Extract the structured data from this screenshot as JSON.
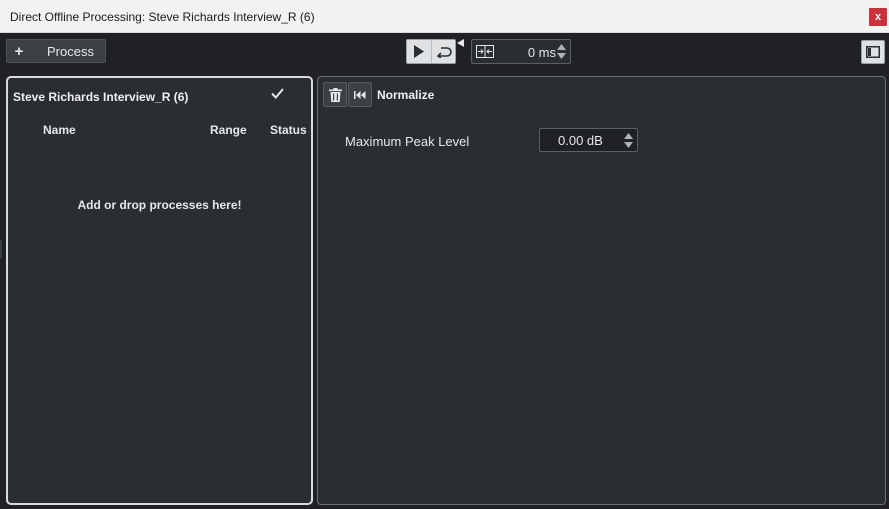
{
  "window": {
    "title": "Direct Offline Processing: Steve Richards Interview_R (6)",
    "close_label": "x"
  },
  "toolbar": {
    "process_label": "Process",
    "add_symbol": "+",
    "preroll_value": "0 ms"
  },
  "left_panel": {
    "title": "Steve Richards Interview_R (6)",
    "columns": {
      "name": "Name",
      "range": "Range",
      "status": "Status"
    },
    "empty_hint": "Add or drop processes here!"
  },
  "right_panel": {
    "title": "Normalize",
    "param_label": "Maximum Peak Level",
    "param_value": "0.00 dB"
  },
  "icons": [
    "plus-icon",
    "play-icon",
    "loop-icon",
    "marker-triangle-icon",
    "range-fit-icon",
    "stepper-icon",
    "panel-layout-icon",
    "checkmark-icon",
    "trash-icon",
    "reset-icon"
  ],
  "colors": {
    "background": "#1f2124",
    "panel": "#2a2d31",
    "titlebar": "#f2f2f2",
    "close": "#c8323b",
    "selection_border": "#d8dadc"
  }
}
